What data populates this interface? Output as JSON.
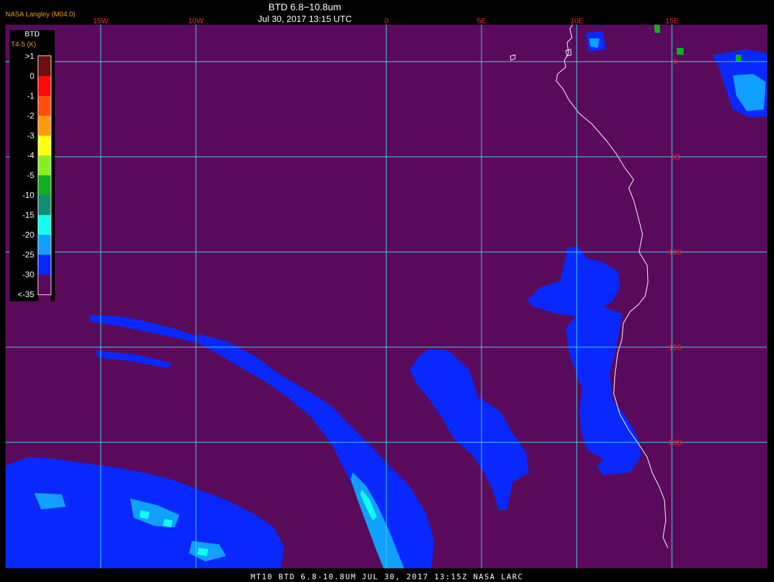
{
  "header": {
    "title": "BTD 6.8−10.8um",
    "time": "Jul 30, 2017 13:15 UTC",
    "producer": "NASA Langley (M04.0)"
  },
  "footer": "MT10  BTD 6.8-10.8UM  JUL 30, 2017 13:15Z  NASA LARC",
  "legend": {
    "title": "BTD",
    "units": "T4-5 (K)",
    "items": [
      {
        "label": ">1",
        "color": "#6b0f0f"
      },
      {
        "label": "0",
        "color": "#ff0a0a"
      },
      {
        "label": "-1",
        "color": "#ff5010"
      },
      {
        "label": "-2",
        "color": "#ff9a10"
      },
      {
        "label": "-3",
        "color": "#ffff10"
      },
      {
        "label": "-4",
        "color": "#88f020"
      },
      {
        "label": "-5",
        "color": "#10b020"
      },
      {
        "label": "-10",
        "color": "#109070"
      },
      {
        "label": "-15",
        "color": "#10ffee"
      },
      {
        "label": "-20",
        "color": "#10a0ff"
      },
      {
        "label": "-25",
        "color": "#0828ff"
      },
      {
        "label": "-30",
        "color": "#5a0a5a"
      },
      {
        "label": "<-35",
        "color": "#5a0a5a"
      }
    ]
  },
  "longitudes": [
    {
      "label": "15W",
      "value": -15
    },
    {
      "label": "10W",
      "value": -10
    },
    {
      "label": "0",
      "value": 0
    },
    {
      "label": "5E",
      "value": 5
    },
    {
      "label": "10E",
      "value": 10
    },
    {
      "label": "15E",
      "value": 15
    }
  ],
  "latitudes": [
    {
      "label": "0",
      "value": 0
    },
    {
      "label": "5S",
      "value": -5
    },
    {
      "label": "10S",
      "value": -10
    },
    {
      "label": "15S",
      "value": -15
    },
    {
      "label": "20S",
      "value": -20
    }
  ],
  "colors": {
    "background": "#5a0a5a",
    "grid": "#40d8e8",
    "grid_label": "#e03030",
    "cloud_low": "#0828ff",
    "cloud_mid": "#10a0ff",
    "cloud_high": "#10ffee",
    "coastline": "#ffffff"
  }
}
